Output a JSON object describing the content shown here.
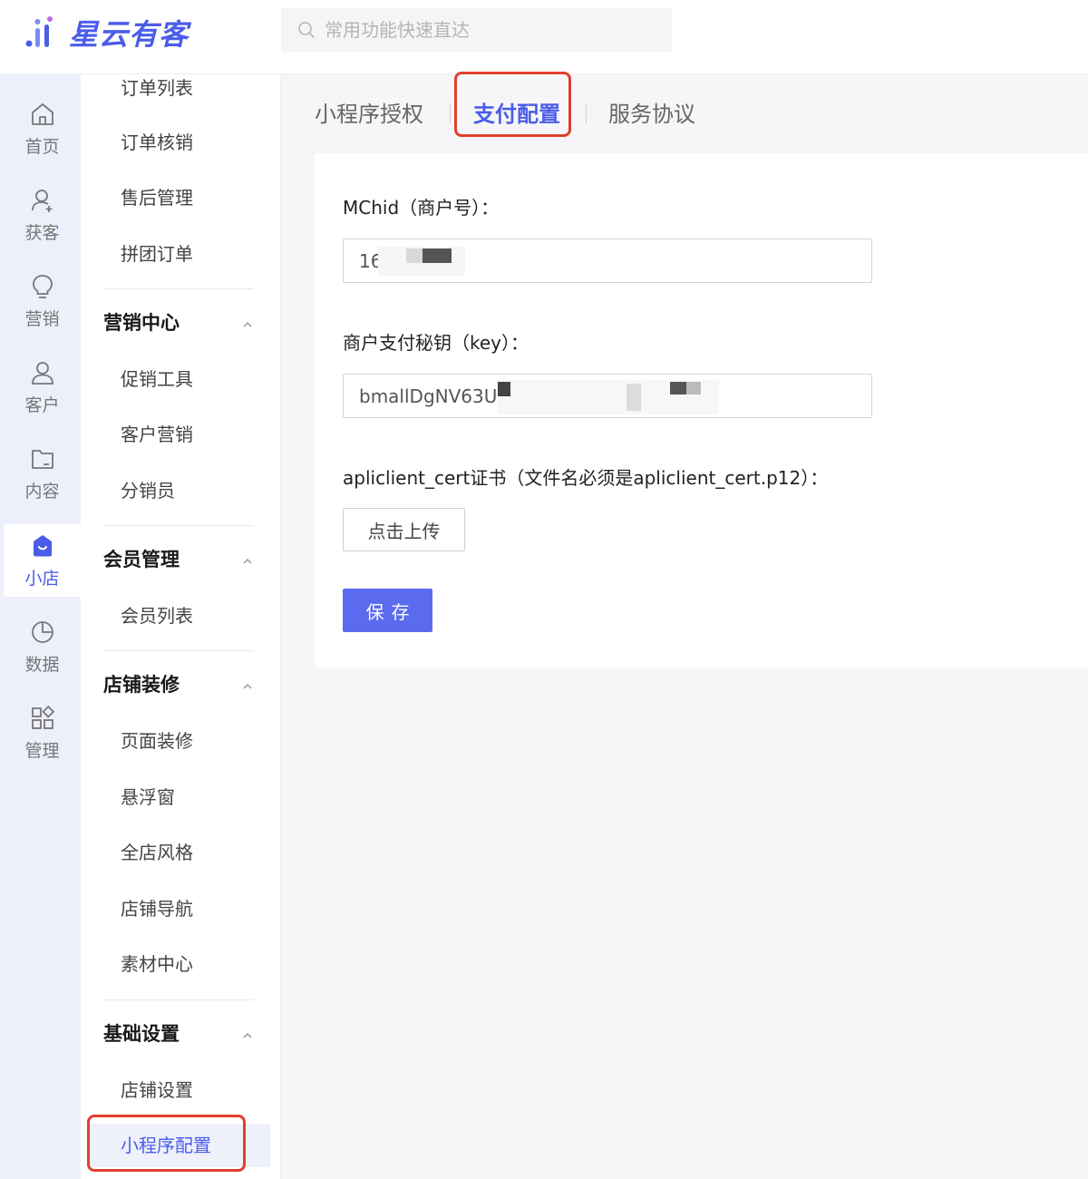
{
  "brand": {
    "name": "星云有客",
    "accent": "#4b5de8"
  },
  "search": {
    "placeholder": "常用功能快速直达",
    "icon": "search-icon"
  },
  "rail": {
    "items": [
      {
        "label": "首页",
        "icon": "home-icon"
      },
      {
        "label": "获客",
        "icon": "user-add-icon"
      },
      {
        "label": "营销",
        "icon": "bulb-icon"
      },
      {
        "label": "客户",
        "icon": "user-icon"
      },
      {
        "label": "内容",
        "icon": "folder-icon"
      },
      {
        "label": "小店",
        "icon": "shop-icon",
        "active": true
      },
      {
        "label": "数据",
        "icon": "pie-chart-icon"
      },
      {
        "label": "管理",
        "icon": "apps-icon"
      }
    ]
  },
  "submenu": {
    "top_items": [
      "订单列表",
      "订单核销",
      "售后管理",
      "拼团订单"
    ],
    "groups": [
      {
        "title": "营销中心",
        "items": [
          "促销工具",
          "客户营销",
          "分销员"
        ]
      },
      {
        "title": "会员管理",
        "items": [
          "会员列表"
        ]
      },
      {
        "title": "店铺装修",
        "items": [
          "页面装修",
          "悬浮窗",
          "全店风格",
          "店铺导航",
          "素材中心"
        ]
      },
      {
        "title": "基础设置",
        "items": [
          "店铺设置",
          "小程序配置"
        ]
      }
    ],
    "active_item": "小程序配置"
  },
  "tabs": [
    {
      "label": "小程序授权"
    },
    {
      "label": "支付配置",
      "active": true
    },
    {
      "label": "服务协议"
    }
  ],
  "form": {
    "mchid_label": "MChid（商户号）：",
    "mchid_value": "16",
    "key_label": "商户支付秘钥（key）：",
    "key_value": "bmallDgNV63U",
    "cert_label": "apliclient_cert证书（文件名必须是apliclient_cert.p12）：",
    "upload_label": "点击上传",
    "save_label": "保存"
  },
  "colors": {
    "highlight_box": "#e0402f",
    "primary_button": "#5b6bef"
  }
}
